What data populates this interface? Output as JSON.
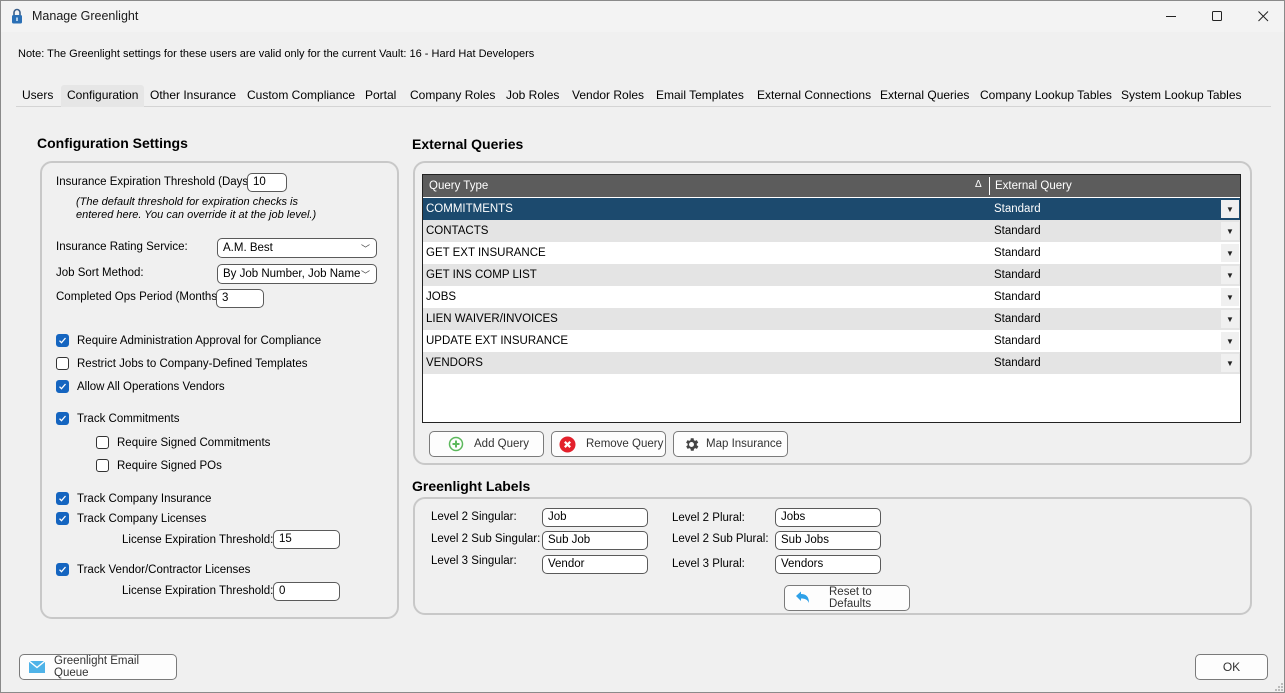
{
  "window": {
    "title": "Manage Greenlight",
    "controls": {
      "minimize": "minimize-icon",
      "maximize": "maximize-icon",
      "close": "close-icon"
    }
  },
  "note": "Note:  The Greenlight settings for these users are valid only for the current Vault: 16 - Hard Hat Developers",
  "tabs": [
    {
      "label": "Users"
    },
    {
      "label": "Configuration",
      "active": true
    },
    {
      "label": "Other Insurance"
    },
    {
      "label": "Custom Compliance"
    },
    {
      "label": "Portal"
    },
    {
      "label": "Company Roles"
    },
    {
      "label": "Job Roles"
    },
    {
      "label": "Vendor Roles"
    },
    {
      "label": "Email Templates"
    },
    {
      "label": "External Connections"
    },
    {
      "label": "External Queries"
    },
    {
      "label": "Company Lookup Tables"
    },
    {
      "label": "System Lookup Tables"
    }
  ],
  "config": {
    "title": "Configuration Settings",
    "ins_exp_label": "Insurance Expiration Threshold (Days):",
    "ins_exp_value": "10",
    "hint_line1": "(The default threshold for expiration checks is",
    "hint_line2": "entered here. You can override it at the job level.)",
    "rating_label": "Insurance Rating Service:",
    "rating_value": "A.M. Best",
    "sort_label": "Job Sort Method:",
    "sort_value": "By Job Number, Job Name",
    "ops_label": "Completed Ops Period (Months):",
    "ops_value": "3",
    "checkboxes": [
      {
        "label": "Require Administration Approval for Compliance",
        "checked": true
      },
      {
        "label": "Restrict Jobs to Company-Defined Templates",
        "checked": false
      },
      {
        "label": "Allow All Operations Vendors",
        "checked": true
      },
      {
        "label": "Track Commitments",
        "checked": true
      },
      {
        "label": "Require Signed Commitments",
        "checked": false
      },
      {
        "label": "Require Signed POs",
        "checked": false
      },
      {
        "label": "Track Company Insurance",
        "checked": true
      },
      {
        "label": "Track Company Licenses",
        "checked": true
      },
      {
        "label": "Track Vendor/Contractor Licenses",
        "checked": true
      }
    ],
    "company_license_label": "License Expiration Threshold:",
    "company_license_value": "15",
    "vendor_license_label": "License Expiration Threshold:",
    "vendor_license_value": "0"
  },
  "queries": {
    "title": "External Queries",
    "columns": [
      "Query Type",
      "External Query"
    ],
    "sort_indicator": "Δ",
    "rows": [
      {
        "type": "COMMITMENTS",
        "query": "Standard",
        "selected": true
      },
      {
        "type": "CONTACTS",
        "query": "Standard"
      },
      {
        "type": "GET EXT INSURANCE",
        "query": "Standard"
      },
      {
        "type": "GET INS COMP LIST",
        "query": "Standard"
      },
      {
        "type": "JOBS",
        "query": "Standard"
      },
      {
        "type": "LIEN WAIVER/INVOICES",
        "query": "Standard"
      },
      {
        "type": "UPDATE EXT INSURANCE",
        "query": "Standard"
      },
      {
        "type": "VENDORS",
        "query": "Standard"
      }
    ],
    "add_label": "Add Query",
    "remove_label": "Remove Query",
    "map_label": "Map Insurance"
  },
  "labels": {
    "title": "Greenlight Labels",
    "l2_singular_label": "Level 2 Singular:",
    "l2_singular_value": "Job",
    "l2_plural_label": "Level 2 Plural:",
    "l2_plural_value": "Jobs",
    "l2_sub_singular_label": "Level 2 Sub Singular:",
    "l2_sub_singular_value": "Sub Job",
    "l2_sub_plural_label": "Level 2 Sub Plural:",
    "l2_sub_plural_value": "Sub Jobs",
    "l3_singular_label": "Level 3 Singular:",
    "l3_singular_value": "Vendor",
    "l3_plural_label": "Level 3 Plural:",
    "l3_plural_value": "Vendors",
    "reset_label": "Reset to Defaults"
  },
  "footer": {
    "email_queue_label": "Greenlight Email Queue",
    "ok_label": "OK"
  },
  "colors": {
    "selected_row": "#1c4a6e",
    "grid_header": "#5c5c5c",
    "checkbox_checked": "#1565c0",
    "row_alt": "#e4e4e4",
    "add_icon": "#5cb85c",
    "remove_icon": "#e3202b",
    "info_icon": "#4fb3e8"
  }
}
